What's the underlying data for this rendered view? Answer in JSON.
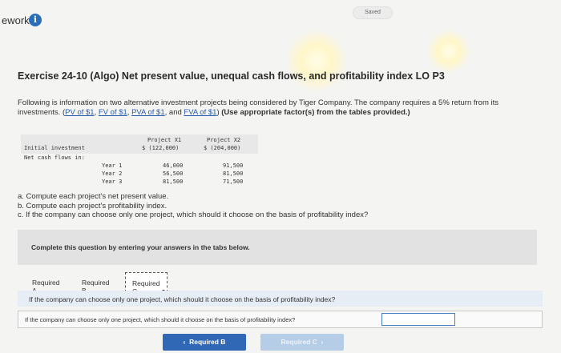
{
  "header": {
    "work_label": "ework",
    "info_icon": "i",
    "saved_label": "Saved"
  },
  "exercise": {
    "title": "Exercise 24-10 (Algo) Net present value, unequal cash flows, and profitability index LO P3",
    "intro_part1": "Following is information on two alternative investment projects being considered by Tiger Company. The company requires a 5% return from its investments. (",
    "links": [
      "PV of $1",
      "FV of $1",
      "PVA of $1",
      "FVA of $1"
    ],
    "sep1": ", ",
    "sep2": ", ",
    "sep3": ", and ",
    "intro_part2": ") ",
    "intro_bold": "(Use appropriate factor(s) from the tables provided.)"
  },
  "table": {
    "col_headers": [
      "Project X1",
      "Project X2"
    ],
    "initial_label": "Initial investment",
    "initial_values": [
      "$ (122,000)",
      "$ (204,000)"
    ],
    "cash_flows_label": "Net cash flows in:",
    "rows": [
      {
        "label": "Year 1",
        "x1": "46,000",
        "x2": "91,500"
      },
      {
        "label": "Year 2",
        "x1": "56,500",
        "x2": "81,500"
      },
      {
        "label": "Year 3",
        "x1": "81,500",
        "x2": "71,500"
      }
    ]
  },
  "questions": [
    "a. Compute each project's net present value.",
    "b. Compute each project's profitability index.",
    "c. If the company can choose only one project, which should it choose on the basis of profitability index?"
  ],
  "complete_prompt": "Complete this question by entering your answers in the tabs below.",
  "tabs": [
    {
      "label": "Required A"
    },
    {
      "label": "Required B"
    },
    {
      "label": "Required C"
    }
  ],
  "question_bar": "If the company can choose only one project, which should it choose on the basis of profitability index?",
  "answer_row": {
    "label": "If the company can choose only one project, which should it choose on the basis of profitability index?",
    "value": ""
  },
  "nav": {
    "prev_label": "Required B",
    "next_label": "Required C"
  },
  "colors": {
    "accent": "#3068b6",
    "info_icon": "#2a6ebb"
  }
}
